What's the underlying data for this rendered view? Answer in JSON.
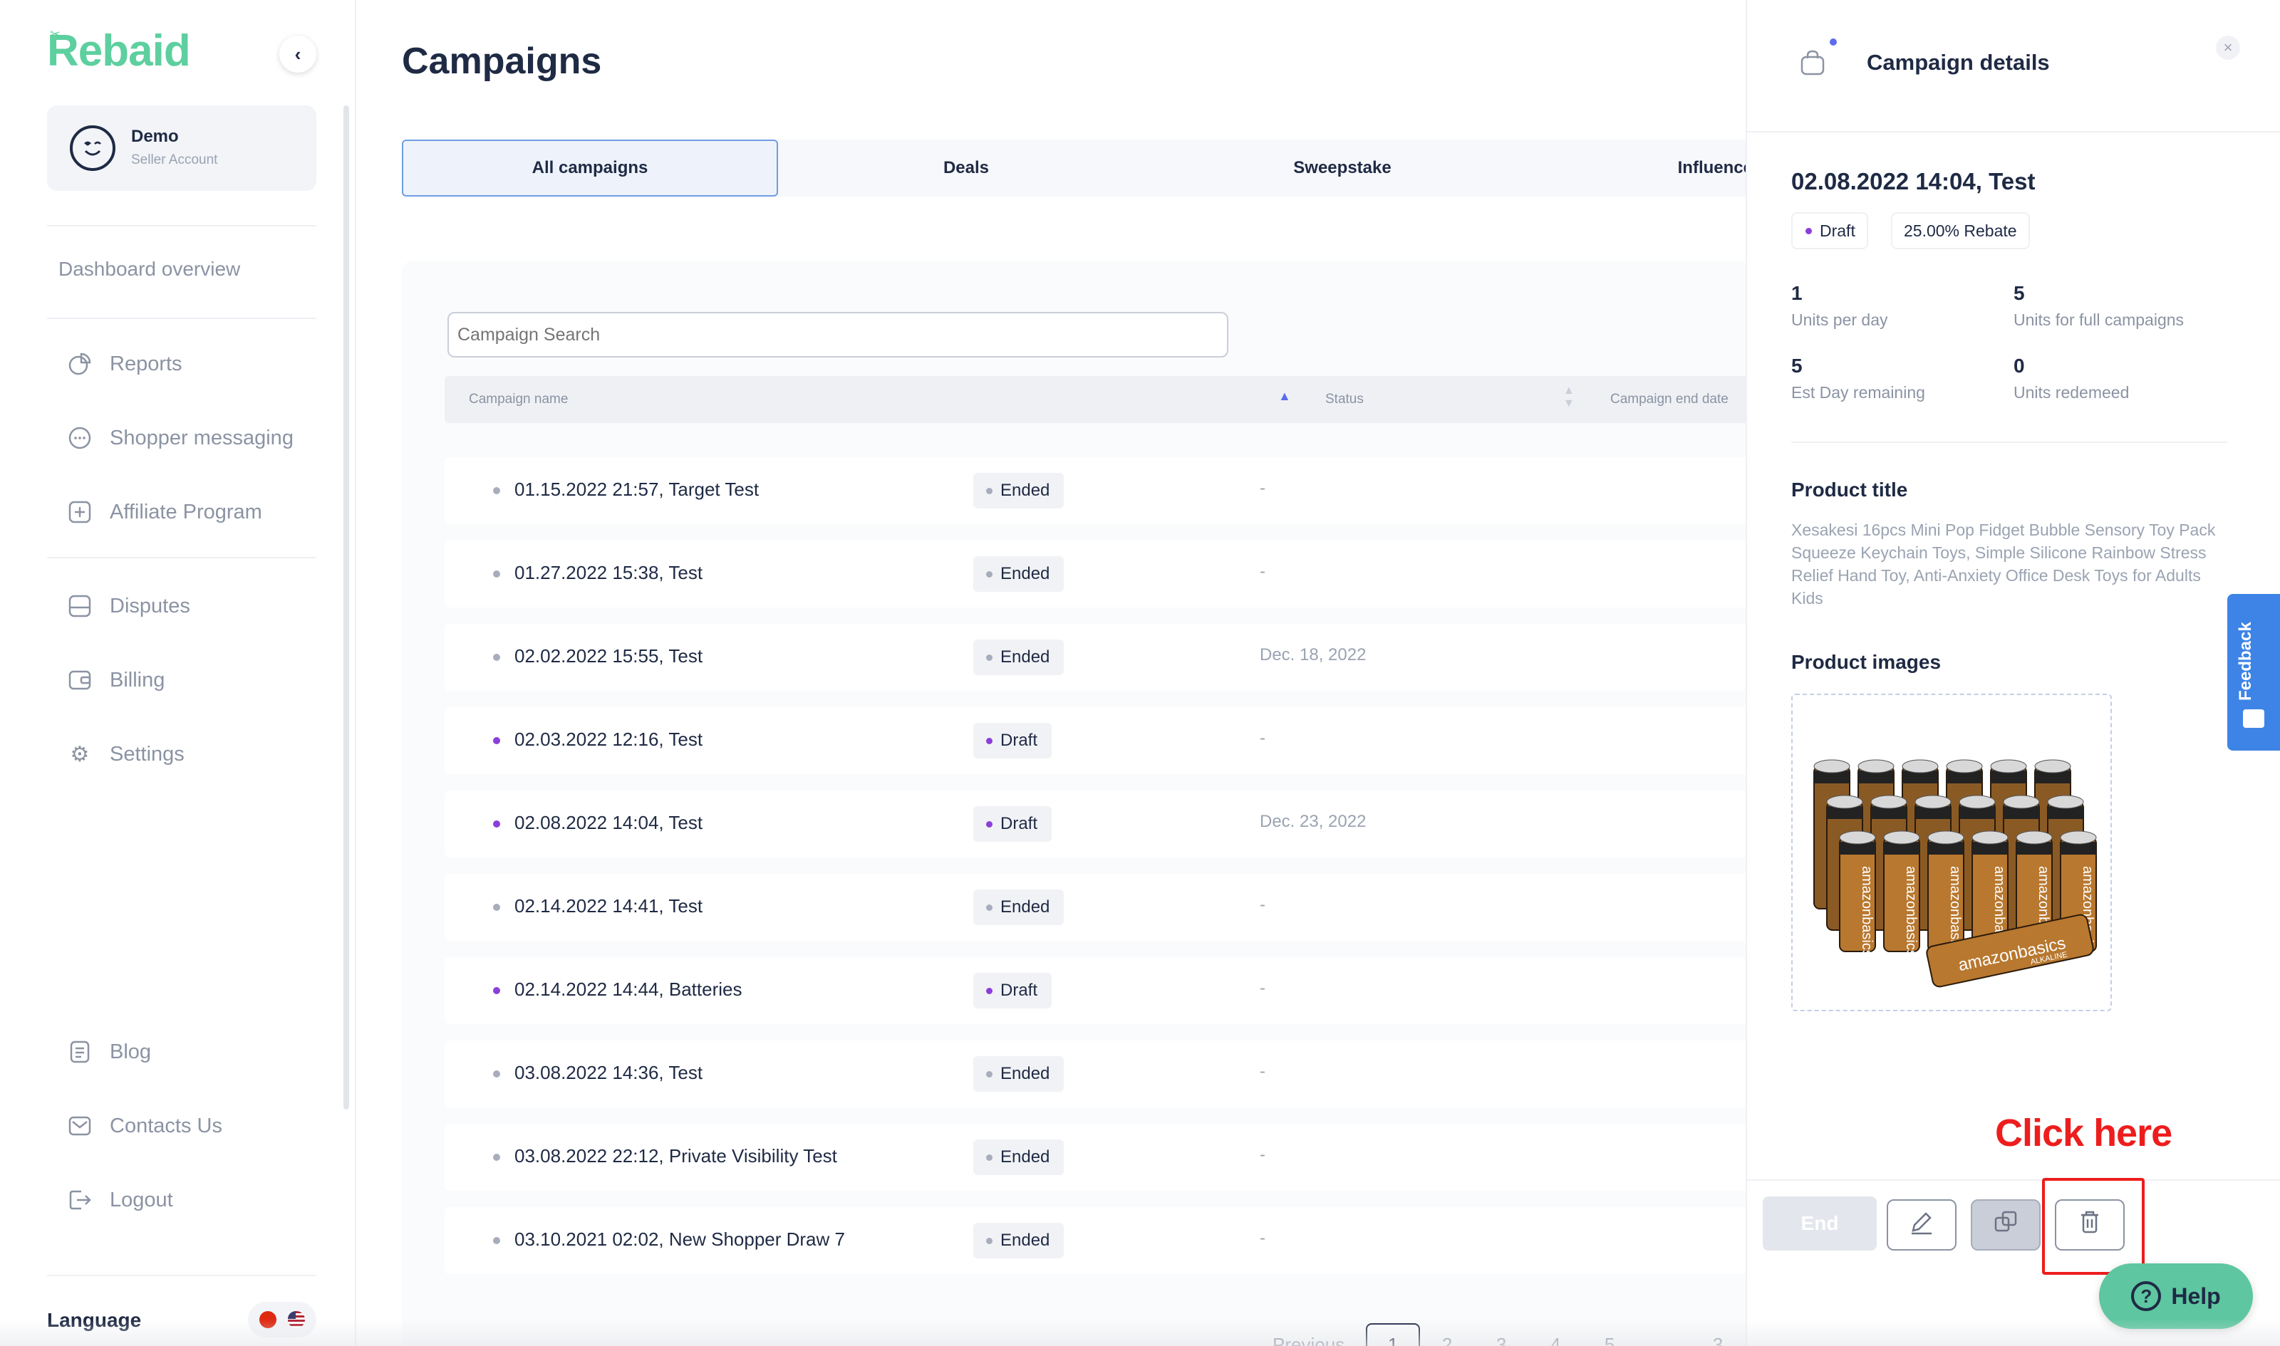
{
  "brand": {
    "logo": "Rebaid",
    "accent": "#5ecf9f"
  },
  "account": {
    "name": "Demo",
    "role": "Seller Account"
  },
  "sidebar": {
    "overview": "Dashboard overview",
    "items": [
      {
        "label": "Reports",
        "icon": "pie-chart-icon"
      },
      {
        "label": "Shopper messaging",
        "icon": "chat-bubble-icon"
      },
      {
        "label": "Affiliate Program",
        "icon": "plus-square-icon"
      },
      {
        "label": "Disputes",
        "icon": "inbox-icon"
      },
      {
        "label": "Billing",
        "icon": "wallet-icon"
      },
      {
        "label": "Settings",
        "icon": "gear-icon"
      },
      {
        "label": "Blog",
        "icon": "document-icon"
      },
      {
        "label": "Contacts Us",
        "icon": "mail-icon"
      },
      {
        "label": "Logout",
        "icon": "logout-icon"
      }
    ],
    "language_label": "Language"
  },
  "main": {
    "title": "Campaigns",
    "tabs": [
      "All campaigns",
      "Deals",
      "Sweepstake",
      "Influencer"
    ],
    "search_placeholder": "Campaign Search",
    "columns": {
      "name": "Campaign name",
      "status": "Status",
      "end": "Campaign end date"
    },
    "rows": [
      {
        "name": "01.15.2022 21:57, Target Test",
        "status": "Ended",
        "end": "-"
      },
      {
        "name": "01.27.2022 15:38, Test",
        "status": "Ended",
        "end": "-"
      },
      {
        "name": "02.02.2022 15:55, Test",
        "status": "Ended",
        "end": "Dec. 18, 2022"
      },
      {
        "name": "02.03.2022 12:16, Test",
        "status": "Draft",
        "end": "-"
      },
      {
        "name": "02.08.2022 14:04, Test",
        "status": "Draft",
        "end": "Dec. 23, 2022"
      },
      {
        "name": "02.14.2022 14:41, Test",
        "status": "Ended",
        "end": "-"
      },
      {
        "name": "02.14.2022 14:44, Batteries",
        "status": "Draft",
        "end": "-"
      },
      {
        "name": "03.08.2022 14:36, Test",
        "status": "Ended",
        "end": "-"
      },
      {
        "name": "03.08.2022 22:12, Private Visibility Test",
        "status": "Ended",
        "end": "-"
      },
      {
        "name": "03.10.2021 02:02, New Shopper Draw 7",
        "status": "Ended",
        "end": "-"
      }
    ],
    "pagination": {
      "previous": "Previous",
      "pages": [
        "1",
        "2",
        "3",
        "4",
        "5",
        "...",
        "3"
      ]
    }
  },
  "details": {
    "header": "Campaign details",
    "campaign_title": "02.08.2022 14:04, Test",
    "status": "Draft",
    "rebate": "25.00% Rebate",
    "stats": [
      {
        "value": "1",
        "label": "Units per day"
      },
      {
        "value": "5",
        "label": "Units for full campaigns"
      },
      {
        "value": "5",
        "label": "Est Day remaining"
      },
      {
        "value": "0",
        "label": "Units redemeed"
      }
    ],
    "product_title_label": "Product title",
    "product_title": "Xesakesi 16pcs Mini Pop Fidget Bubble Sensory Toy Pack Squeeze Keychain Toys, Simple Silicone Rainbow Stress Relief Hand Toy, Anti-Anxiety Office Desk Toys for Adults Kids",
    "product_images_label": "Product images",
    "product_image_brand": "amazonbasics",
    "product_image_sub": "ALKALINE",
    "end_button": "End",
    "annotation": "Click here"
  },
  "feedback_label": "Feedback",
  "help_label": "Help"
}
